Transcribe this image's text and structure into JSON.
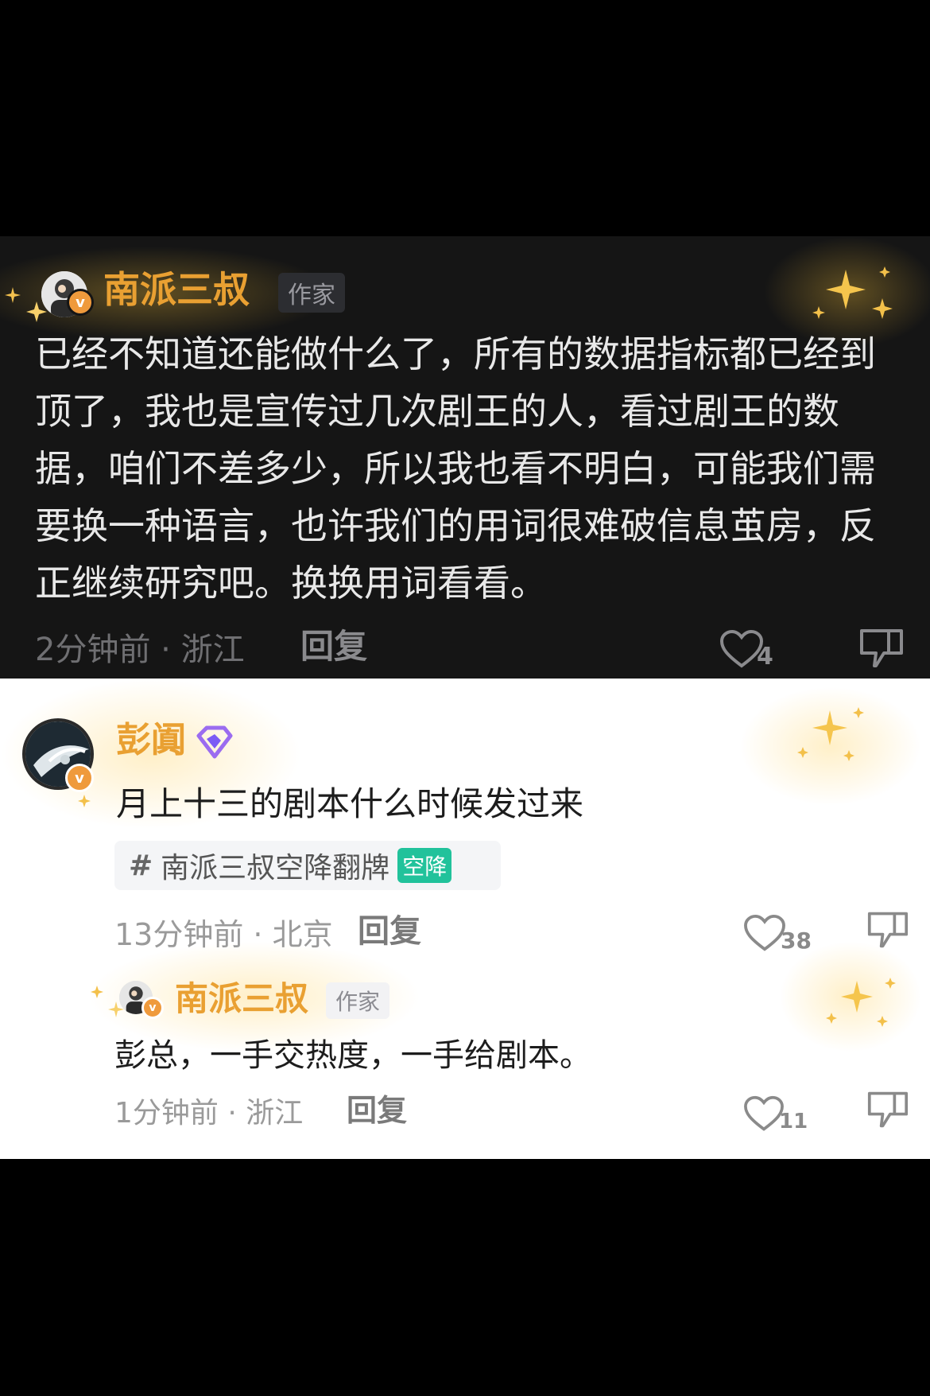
{
  "dark_comment": {
    "author": "南派三叔",
    "author_tag": "作家",
    "badge": "v",
    "text": "已经不知道还能做什么了，所有的数据指标都已经到顶了，我也是宣传过几次剧王的人，看过剧王的数据，咱们不差多少，所以我也看不明白，可能我们需要换一种语言，也许我们的用词很难破信息茧房，反正继续研究吧。换换用词看看。",
    "time_location": "2分钟前 · 浙江",
    "reply_label": "回复",
    "likes": "4",
    "like_icon": "heart-outline-icon",
    "dislike_icon": "thumb-down-icon"
  },
  "light_comment": {
    "author": "彭阗",
    "badge": "v",
    "author_icon": "purple-diamond-badge-icon",
    "text": "月上十三的剧本什么时候发过来",
    "topic": {
      "hash": "#",
      "label": "南派三叔空降翻牌",
      "chip": "空降"
    },
    "time_location": "13分钟前 · 北京",
    "reply_label": "回复",
    "likes": "38",
    "reply": {
      "author": "南派三叔",
      "author_tag": "作家",
      "badge": "v",
      "text": "彭总，一手交热度，一手给剧本。",
      "time_location": "1分钟前 · 浙江",
      "reply_label": "回复",
      "likes": "11"
    }
  },
  "colors": {
    "name_gold": "#e9a032",
    "badge_orange": "#ef9a3c",
    "topic_chip": "#21c29b",
    "dark_bg": "#151515"
  }
}
